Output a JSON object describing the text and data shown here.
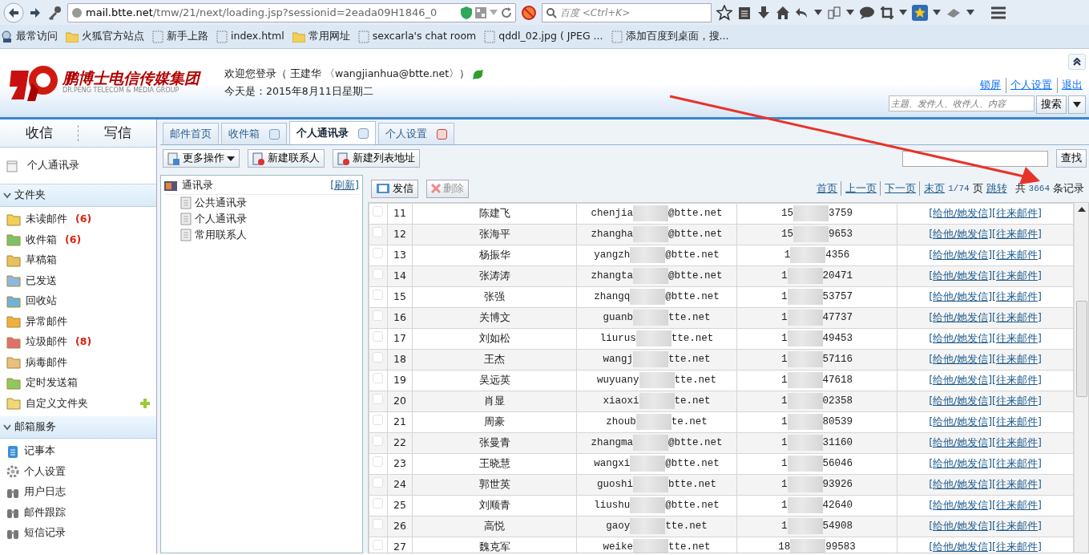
{
  "browser": {
    "url_host": "mail.btte.net",
    "url_path": "/tmw/21/next/loading.jsp?sessionid=2eada09H1846_0",
    "search_placeholder": "百度 <Ctrl+K>",
    "bookmarks": [
      {
        "label": "最常访问",
        "kind": "recent"
      },
      {
        "label": "火狐官方站点",
        "kind": "folder"
      },
      {
        "label": "新手上路",
        "kind": "page"
      },
      {
        "label": "index.html",
        "kind": "page"
      },
      {
        "label": "常用网址",
        "kind": "folder"
      },
      {
        "label": "sexcarla's chat room",
        "kind": "page"
      },
      {
        "label": "qddl_02.jpg ( JPEG ...",
        "kind": "page"
      },
      {
        "label": "添加百度到桌面，搜...",
        "kind": "page"
      }
    ]
  },
  "header": {
    "company": "鹏博士电信传媒集团",
    "company_en": "DR.PENG TELECOM & MEDIA GROUP",
    "welcome": "欢迎您登录（ 王建华  〈wangjianhua@btte.net〉）",
    "date": "今天是：2015年8月11日星期二",
    "links": [
      "锁屏",
      "个人设置",
      "退出"
    ],
    "search_placeholder": "主题、发件人、收件人、内容",
    "search_button": "搜索"
  },
  "sidebar": {
    "top_buttons": [
      "收信",
      "写信"
    ],
    "contacts_item": "个人通讯录",
    "sections": [
      {
        "title": "文件夹",
        "expanded": true,
        "items": [
          {
            "label": "未读邮件",
            "count": "(6)"
          },
          {
            "label": "收件箱",
            "count": "(6)"
          },
          {
            "label": "草稿箱"
          },
          {
            "label": "已发送"
          },
          {
            "label": "回收站"
          },
          {
            "label": "异常邮件"
          },
          {
            "label": "垃圾邮件",
            "count": "(8)"
          },
          {
            "label": "病毒邮件"
          },
          {
            "label": "定时发送箱"
          },
          {
            "label": "自定义文件夹",
            "addable": true
          }
        ]
      },
      {
        "title": "邮箱服务",
        "expanded": true,
        "items": [
          {
            "label": "记事本"
          },
          {
            "label": "个人设置"
          },
          {
            "label": "用户日志"
          },
          {
            "label": "邮件跟踪"
          },
          {
            "label": "短信记录"
          }
        ]
      }
    ]
  },
  "tabs": [
    {
      "label": "邮件首页",
      "selected": false,
      "closable": false
    },
    {
      "label": "收件箱",
      "selected": false,
      "closable": true
    },
    {
      "label": "个人通讯录",
      "selected": true,
      "closable": true
    },
    {
      "label": "个人设置",
      "selected": false,
      "closable": true
    }
  ],
  "toolbar": {
    "buttons": [
      {
        "label": "更多操作",
        "dropdown": true
      },
      {
        "label": "新建联系人",
        "dropdown": false
      },
      {
        "label": "新建列表地址",
        "dropdown": false
      }
    ],
    "search_button": "查找"
  },
  "tree": {
    "root": "通讯录",
    "refresh": "[刷新]",
    "children": [
      "公共通讯录",
      "个人通讯录",
      "常用联系人"
    ]
  },
  "list_toolbar": {
    "buttons": [
      {
        "label": "发信",
        "disabled": false
      },
      {
        "label": "删除",
        "disabled": true
      }
    ]
  },
  "pager": {
    "links": [
      "首页",
      "上一页",
      "下一页",
      "末页"
    ],
    "page": "1/74",
    "page_suffix": "页",
    "jump": "跳转",
    "total_prefix": "共",
    "total": "3664",
    "total_suffix": "条记录"
  },
  "rows": [
    {
      "no": "11",
      "name": "陈建飞",
      "email_start": "chenjia",
      "email_end": "@btte.net",
      "phone_start": "15",
      "phone_end": "3759",
      "checked": false,
      "actions": [
        "[给他/她发信]",
        "[往来邮件]"
      ]
    },
    {
      "no": "12",
      "name": "张海平",
      "email_start": "zhangha",
      "email_end": "@btte.net",
      "phone_start": "15",
      "phone_end": "9653",
      "checked": false,
      "actions": [
        "[给他/她发信]",
        "[往来邮件]"
      ]
    },
    {
      "no": "13",
      "name": "杨振华",
      "email_start": "yangzh",
      "email_end": "@btte.net",
      "phone_start": "1",
      "phone_end": "4356",
      "checked": false,
      "actions": [
        "[给他/她发信]",
        "[往来邮件]"
      ]
    },
    {
      "no": "14",
      "name": "张涛涛",
      "email_start": "zhangta",
      "email_end": "@btte.net",
      "phone_start": "1",
      "phone_end": "20471",
      "checked": false,
      "actions": [
        "[给他/她发信]",
        "[往来邮件]"
      ]
    },
    {
      "no": "15",
      "name": "张强",
      "email_start": "zhangq",
      "email_end": "@btte.net",
      "phone_start": "1",
      "phone_end": "53757",
      "checked": false,
      "actions": [
        "[给他/她发信]",
        "[往来邮件]"
      ]
    },
    {
      "no": "16",
      "name": "关博文",
      "email_start": "guanb",
      "email_end": "tte.net",
      "phone_start": "1",
      "phone_end": "47737",
      "checked": false,
      "actions": [
        "[给他/她发信]",
        "[往来邮件]"
      ]
    },
    {
      "no": "17",
      "name": "刘如松",
      "email_start": "liurus",
      "email_end": "tte.net",
      "phone_start": "1",
      "phone_end": "49453",
      "checked": false,
      "actions": [
        "[给他/她发信]",
        "[往来邮件]"
      ]
    },
    {
      "no": "18",
      "name": "王杰",
      "email_start": "wangj",
      "email_end": "tte.net",
      "phone_start": "1",
      "phone_end": "57116",
      "checked": false,
      "actions": [
        "[给他/她发信]",
        "[往来邮件]"
      ]
    },
    {
      "no": "19",
      "name": "吴远英",
      "email_start": "wuyuany",
      "email_end": "tte.net",
      "phone_start": "1",
      "phone_end": "47618",
      "checked": false,
      "actions": [
        "[给他/她发信]",
        "[往来邮件]"
      ]
    },
    {
      "no": "20",
      "name": "肖显",
      "email_start": "xiaoxi",
      "email_end": "te.net",
      "phone_start": "1",
      "phone_end": "02358",
      "checked": false,
      "actions": [
        "[给他/她发信]",
        "[往来邮件]"
      ]
    },
    {
      "no": "21",
      "name": "周豪",
      "email_start": "zhoub",
      "email_end": "te.net",
      "phone_start": "1",
      "phone_end": "80539",
      "checked": false,
      "actions": [
        "[给他/她发信]",
        "[往来邮件]"
      ]
    },
    {
      "no": "22",
      "name": "张曼青",
      "email_start": "zhangma",
      "email_end": "@btte.net",
      "phone_start": "1",
      "phone_end": "31160",
      "checked": false,
      "actions": [
        "[给他/她发信]",
        "[往来邮件]"
      ]
    },
    {
      "no": "23",
      "name": "王晓慧",
      "email_start": "wangxi",
      "email_end": "@btte.net",
      "phone_start": "1",
      "phone_end": "56046",
      "checked": false,
      "actions": [
        "[给他/她发信]",
        "[往来邮件]"
      ]
    },
    {
      "no": "24",
      "name": "郭世英",
      "email_start": "guoshi",
      "email_end": "btte.net",
      "phone_start": "1",
      "phone_end": "93926",
      "checked": false,
      "actions": [
        "[给他/她发信]",
        "[往来邮件]"
      ]
    },
    {
      "no": "25",
      "name": "刘顺青",
      "email_start": "liushu",
      "email_end": "@btte.net",
      "phone_start": "1",
      "phone_end": "42640",
      "checked": false,
      "actions": [
        "[给他/她发信]",
        "[往来邮件]"
      ]
    },
    {
      "no": "26",
      "name": "高悦",
      "email_start": "gaoy",
      "email_end": "tte.net",
      "phone_start": "1",
      "phone_end": "54908",
      "checked": false,
      "actions": [
        "[给他/她发信]",
        "[往来邮件]"
      ]
    },
    {
      "no": "27",
      "name": "魏克军",
      "email_start": "weike",
      "email_end": "tte.net",
      "phone_start": "18",
      "phone_end": "99583",
      "checked": false,
      "actions": [
        "[给他/她发信]",
        "[往来邮件]"
      ]
    }
  ]
}
